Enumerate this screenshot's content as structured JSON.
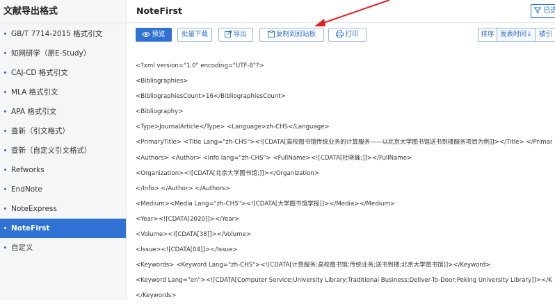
{
  "sidebar": {
    "title": "文献导出格式",
    "items": [
      {
        "label": "GB/T 7714-2015 格式引文",
        "active": false
      },
      {
        "label": "知网研学（原E-Study）",
        "active": false
      },
      {
        "label": "CAJ-CD 格式引文",
        "active": false
      },
      {
        "label": "MLA 格式引文",
        "active": false
      },
      {
        "label": "APA 格式引文",
        "active": false
      },
      {
        "label": "查新（引文格式）",
        "active": false
      },
      {
        "label": "查新（自定义引文格式）",
        "active": false
      },
      {
        "label": "Refworks",
        "active": false
      },
      {
        "label": "EndNote",
        "active": false
      },
      {
        "label": "NoteExpress",
        "active": false
      },
      {
        "label": "NoteFirst",
        "active": true
      },
      {
        "label": "自定义",
        "active": false
      }
    ]
  },
  "main": {
    "title": "NoteFirst",
    "top_right_button": "已选"
  },
  "toolbar": {
    "preview": "预览",
    "batch_download": "批量下载",
    "export": "导出",
    "copy_clipboard": "复制到剪贴板",
    "print": "打印"
  },
  "sort": {
    "sort_label": "排序",
    "publish_time": "发表时间",
    "publish_time_arrow": "↓",
    "cited": "被引"
  },
  "xml_lines": [
    "<?xml version=\"1.0\" encoding=\"UTF-8\"?>",
    "<Bibliographies>",
    "<BibliographiesCount>16</BibliographiesCount>",
    "<Bibliography>",
    "<Type>JournalArticle</Type> <Language>zh-CHS</Language>",
    "<PrimaryTitle> <Title Lang=\"zh-CHS\"><![CDATA[高校图书馆传统业务的计算服务——以北京大学图书馆送书到楼服务项目为例]]></Title> </PrimaryTitle>",
    "<Authors> <Author> <Info lang=\"zh-CHS\"> <FullName><![CDATA[杜晓峰;]]></FullName>",
    "<Organization><![CDATA[北京大学图书馆;]]></Organization>",
    "</Info> </Author> </Authors>",
    "<Medium><Media Lang=\"zh-CHS\"><![CDATA[大学图书馆学报]]></Media></Medium>",
    "<Year><![CDATA[2020]]></Year>",
    "<Volume><![CDATA[38]]></Volume>",
    "<Issue><![CDATA[04]]></Issue>",
    "<Keywords> <Keyword Lang=\"zh-CHS\"><![CDATA[计算服务;高校图书馆;传统业务;送书到楼;北京大学图书馆]]></Keyword>",
    "<Keyword Lang=\"en\"><![CDATA[Computer Service;University Library;Traditional Business;Deliver-To-Door;Peking University Library]]></Keyword>",
    "</Keywords>"
  ],
  "colors": {
    "accent": "#2f72d4",
    "sidebar_bg": "#f5f6f8",
    "annotation_arrow": "#e02020"
  }
}
